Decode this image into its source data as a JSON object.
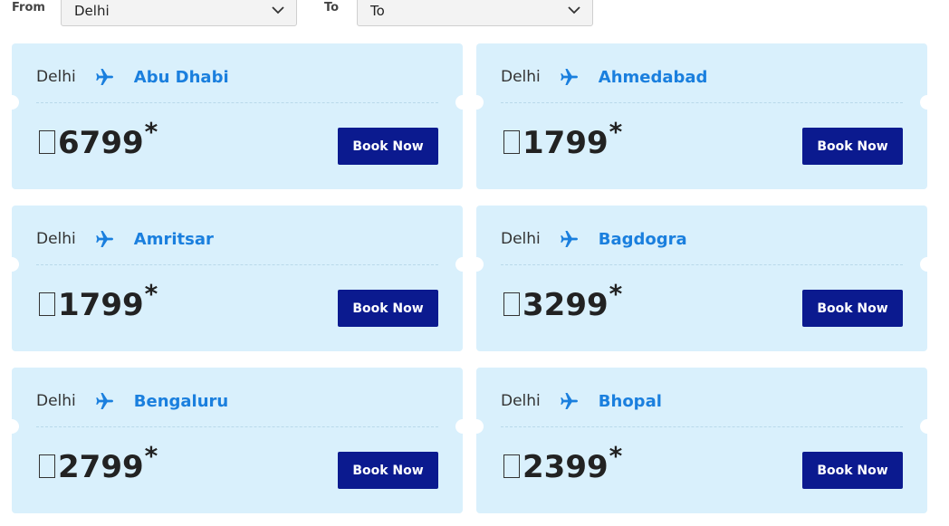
{
  "filters": {
    "from_label": "From",
    "from_value": "Delhi",
    "to_label": "To",
    "to_value": "To"
  },
  "colors": {
    "card_bg": "#d9f0fc",
    "accent": "#1a7fde",
    "button_bg": "#0b1a8f"
  },
  "icons": {
    "route": "airplane-icon",
    "dropdown": "chevron-down-icon",
    "currency": "rupee-icon"
  },
  "fares": [
    {
      "origin": "Delhi",
      "destination": "Abu Dhabi",
      "price": "6799",
      "asterisk": "*",
      "button": "Book Now"
    },
    {
      "origin": "Delhi",
      "destination": "Ahmedabad",
      "price": "1799",
      "asterisk": "*",
      "button": "Book Now"
    },
    {
      "origin": "Delhi",
      "destination": "Amritsar",
      "price": "1799",
      "asterisk": "*",
      "button": "Book Now"
    },
    {
      "origin": "Delhi",
      "destination": "Bagdogra",
      "price": "3299",
      "asterisk": "*",
      "button": "Book Now"
    },
    {
      "origin": "Delhi",
      "destination": "Bengaluru",
      "price": "2799",
      "asterisk": "*",
      "button": "Book Now"
    },
    {
      "origin": "Delhi",
      "destination": "Bhopal",
      "price": "2399",
      "asterisk": "*",
      "button": "Book Now"
    }
  ]
}
